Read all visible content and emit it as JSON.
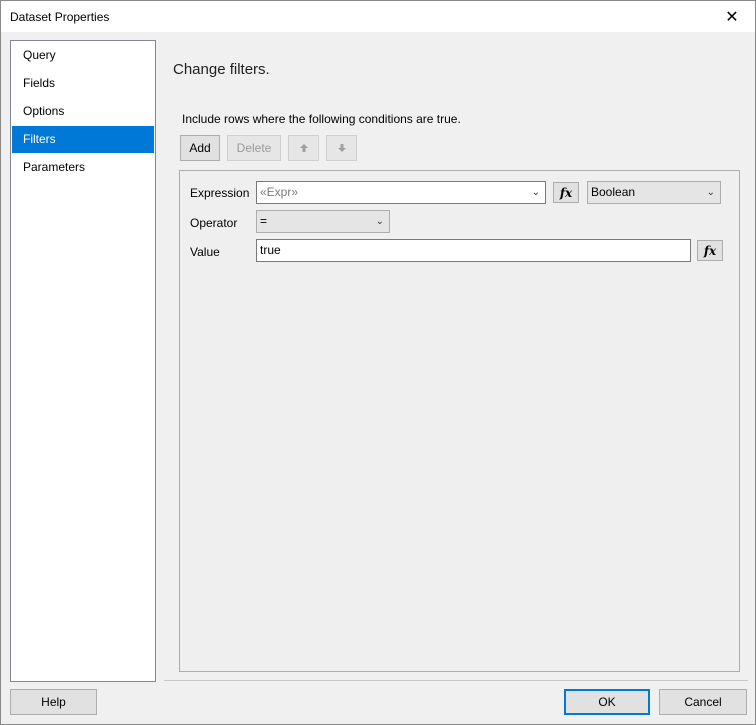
{
  "window": {
    "title": "Dataset Properties"
  },
  "nav": {
    "items": [
      {
        "label": "Query"
      },
      {
        "label": "Fields"
      },
      {
        "label": "Options"
      },
      {
        "label": "Filters",
        "selected": true
      },
      {
        "label": "Parameters"
      }
    ]
  },
  "page": {
    "heading": "Change filters.",
    "description": "Include rows where the following conditions are true."
  },
  "toolbar": {
    "add_label": "Add",
    "delete_label": "Delete",
    "move_up_icon": "arrow-up-icon",
    "move_down_icon": "arrow-down-icon"
  },
  "filter": {
    "expression_label": "Expression",
    "expression_placeholder": "«Expr»",
    "expression_type": "Boolean",
    "operator_label": "Operator",
    "operator_value": "=",
    "value_label": "Value",
    "value_value": "true",
    "fx_label": "fx"
  },
  "footer": {
    "help_label": "Help",
    "ok_label": "OK",
    "cancel_label": "Cancel"
  },
  "colors": {
    "selection": "#0078d7",
    "panel_bg": "#efefef"
  }
}
